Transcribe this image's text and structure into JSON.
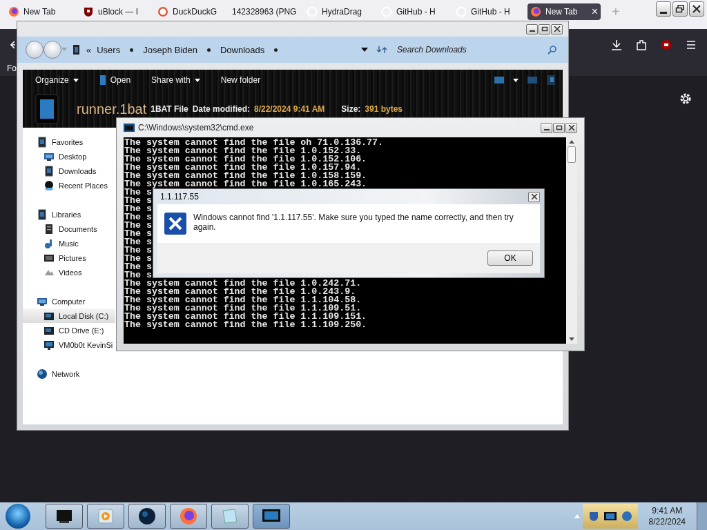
{
  "browser": {
    "tabs": [
      {
        "title": "New Tab",
        "selected": false
      },
      {
        "title": "uBlock — I",
        "selected": false
      },
      {
        "title": "DuckDuckG",
        "selected": false
      },
      {
        "title": "142328963 (PNG",
        "selected": false
      },
      {
        "title": "HydraDrag",
        "selected": false
      },
      {
        "title": "GitHub - H",
        "selected": false
      },
      {
        "title": "GitHub - H",
        "selected": false
      },
      {
        "title": "New Tab",
        "selected": true
      }
    ],
    "close_tab": "×",
    "new_tab": "+",
    "bookmark": "Fo"
  },
  "explorer": {
    "overflow": "«",
    "breadcrumb": [
      "Users",
      "Joseph Biden",
      "Downloads"
    ],
    "search": {
      "placeholder": "Search Downloads"
    },
    "commands": [
      {
        "label": "Organize",
        "dropdown": true
      },
      {
        "label": "Open",
        "dropdown": false
      },
      {
        "label": "Share with",
        "dropdown": true
      },
      {
        "label": "New folder",
        "dropdown": false
      }
    ],
    "details": {
      "name": "runner.1bat",
      "type": "1BAT File",
      "fields": [
        {
          "label": "Date modified:",
          "value": "8/22/2024 9:41 AM"
        },
        {
          "label": "Size:",
          "value": "391 bytes"
        }
      ]
    },
    "nav": [
      {
        "label": "Favorites",
        "selected": false,
        "children": [
          {
            "label": "Desktop",
            "selected": false
          },
          {
            "label": "Downloads",
            "selected": false
          },
          {
            "label": "Recent Places",
            "selected": false
          }
        ]
      },
      {
        "label": "Libraries",
        "selected": false,
        "children": [
          {
            "label": "Documents",
            "selected": false
          },
          {
            "label": "Music",
            "selected": false
          },
          {
            "label": "Pictures",
            "selected": false
          },
          {
            "label": "Videos",
            "selected": false
          }
        ]
      },
      {
        "label": "Computer",
        "selected": false,
        "children": [
          {
            "label": "Local Disk (C:)",
            "selected": true
          },
          {
            "label": "CD Drive (E:)",
            "selected": false
          },
          {
            "label": "VM0b0t KevinSi",
            "selected": false
          }
        ]
      },
      {
        "label": "Network",
        "selected": false
      }
    ]
  },
  "cmd": {
    "title": "C:\\Windows\\system32\\cmd.exe",
    "lines": [
      "The system cannot find the file oh 71.0.136.77.",
      "The system cannot find the file 1.0.152.33.",
      "The system cannot find the file 1.0.152.106.",
      "The system cannot find the file 1.0.157.94.",
      "The system cannot find the file 1.0.158.159.",
      "The system cannot find the file 1.0.165.243.",
      "The s",
      "The s",
      "The s",
      "The s",
      "The s",
      "The s",
      "The s",
      "The s",
      "The s",
      "The s",
      "The s",
      "The system cannot find the file 1.0.242.71.",
      "The system cannot find the file 1.0.243.9.",
      "The system cannot find the file 1.1.104.58.",
      "The system cannot find the file 1.1.109.51.",
      "The system cannot find the file 1.1.109.151.",
      "The system cannot find the file 1.1.109.250."
    ]
  },
  "dialog": {
    "title": "1.1.117.55",
    "message": "Windows cannot find '1.1.117.55'. Make sure you typed the name correctly, and then try again.",
    "button": "OK"
  },
  "taskbar": {
    "time": "9:41 AM",
    "date": "8/22/2024"
  }
}
